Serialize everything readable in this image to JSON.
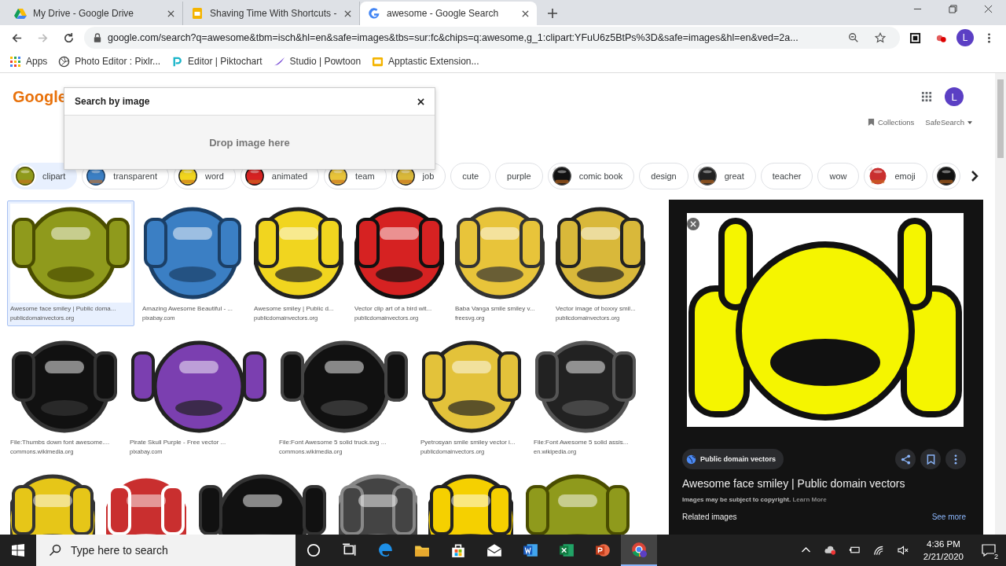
{
  "browser": {
    "tabs": [
      {
        "title": "My Drive - Google Drive",
        "selected": false
      },
      {
        "title": "Shaving Time With Shortcuts -",
        "selected": false
      },
      {
        "title": "awesome - Google Search",
        "selected": true
      }
    ],
    "url": "google.com/search?q=awesome&tbm=isch&hl=en&safe=images&tbs=sur:fc&chips=q:awesome,g_1:clipart:YFuU6z5BtPs%3D&safe=images&hl=en&ved=2a...",
    "profile_initial": "L",
    "bookmarks": [
      {
        "label": "Apps"
      },
      {
        "label": "Photo Editor : Pixlr..."
      },
      {
        "label": "Editor | Piktochart"
      },
      {
        "label": "Studio | Powtoon"
      },
      {
        "label": "Apptastic Extension..."
      }
    ]
  },
  "page": {
    "logo": "Google",
    "avatar": "L",
    "collections": "Collections",
    "safesearch": "SafeSearch",
    "modal": {
      "title": "Search by image",
      "drop_text": "Drop image here"
    },
    "chips": [
      {
        "label": "clipart",
        "kind": "thumb",
        "selected": true
      },
      {
        "label": "transparent",
        "kind": "thumb",
        "selected": false
      },
      {
        "label": "word",
        "kind": "thumb",
        "selected": false
      },
      {
        "label": "animated",
        "kind": "thumb",
        "selected": false
      },
      {
        "label": "team",
        "kind": "thumb",
        "selected": false
      },
      {
        "label": "job",
        "kind": "thumb",
        "selected": false
      },
      {
        "label": "cute",
        "kind": "text",
        "selected": false
      },
      {
        "label": "purple",
        "kind": "text",
        "selected": false
      },
      {
        "label": "comic book",
        "kind": "thumb",
        "selected": false
      },
      {
        "label": "design",
        "kind": "text",
        "selected": false
      },
      {
        "label": "great",
        "kind": "thumb",
        "selected": false
      },
      {
        "label": "teacher",
        "kind": "text",
        "selected": false
      },
      {
        "label": "wow",
        "kind": "text",
        "selected": false
      },
      {
        "label": "emoji",
        "kind": "thumb",
        "selected": false
      },
      {
        "kind": "thumb",
        "selected": false
      }
    ],
    "result_rows": [
      [
        {
          "title": "Awesome face smiley | Public doma...",
          "source": "publicdomainvectors.org",
          "selected": true
        },
        {
          "title": "Amazing Awesome Beautiful - ...",
          "source": "pixabay.com",
          "selected": false
        },
        {
          "title": "Awesome smiley | Public d...",
          "source": "publicdomainvectors.org",
          "selected": false
        },
        {
          "title": "Vector clip art of a bird wit...",
          "source": "publicdomainvectors.org",
          "selected": false
        },
        {
          "title": "Baba Vanga smile smiley v...",
          "source": "freesvg.org",
          "selected": false
        },
        {
          "title": "Vector image of boxxy smil...",
          "source": "publicdomainvectors.org",
          "selected": false
        }
      ],
      [
        {
          "title": "File:Thumbs down font awesome....",
          "source": "commons.wikimedia.org",
          "selected": false
        },
        {
          "title": "Pirate Skull Purple - Free vector ...",
          "source": "pixabay.com",
          "selected": false
        },
        {
          "title": "File:Font Awesome 5 solid truck.svg ...",
          "source": "commons.wikimedia.org",
          "selected": false
        },
        {
          "title": "Pyetrosyan smile smiley vector i...",
          "source": "publicdomainvectors.org",
          "selected": false
        },
        {
          "title": "File:Font Awesome 5 solid assis...",
          "source": "en.wikipedia.org",
          "selected": false
        }
      ]
    ],
    "panel": {
      "source": "Public domain vectors",
      "title": "Awesome face smiley | Public domain vectors",
      "copyright": "Images may be subject to copyright.",
      "learn_more": "Learn More",
      "related": "Related images",
      "see_more": "See more"
    }
  },
  "taskbar": {
    "search_placeholder": "Type here to search",
    "time": "4:36 PM",
    "date": "2/21/2020",
    "notifications": "2"
  }
}
